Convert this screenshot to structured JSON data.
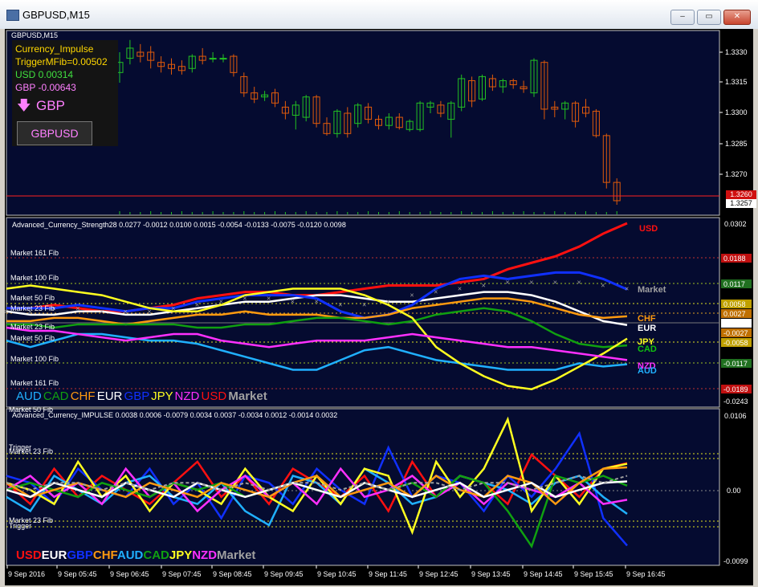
{
  "window": {
    "title": "GBPUSD,M15",
    "min": "‒",
    "max": "▭",
    "close": "✕"
  },
  "main": {
    "symbol": "GBPUSD,M15",
    "indicator_name": "Currency_Impulse",
    "trigger": "TriggerMFib=0.00502",
    "usd": "USD 0.00314",
    "gbp": "GBP -0.00643",
    "arrow": "🡇",
    "arrow_label": "GBP",
    "button": "GBPUSD",
    "price_ticks": [
      "1.3330",
      "1.3315",
      "1.3300",
      "1.3285",
      "1.3270"
    ],
    "bid_label": "1.3260",
    "ask_label": "1.3257",
    "colors": {
      "bull": "#22c022",
      "bear": "#e05a0a",
      "bid": "#ff2020"
    }
  },
  "strength": {
    "header": "Advanced_Currency_Strength28  0.0277 -0.0012 0.0100 0.0015 -0.0054 -0.0133 -0.0075 -0.0120 0.0098",
    "fib_labels": [
      "Market 161 Fib",
      "Market 100 Fib",
      "Market 50 Fib",
      "Market 23 Fib",
      "Market 23 Fib",
      "Market 50 Fib",
      "Market 100 Fib",
      "Market 161 Fib"
    ],
    "right_tags": [
      "USD",
      "Market",
      "CHF",
      "EUR",
      "JPY",
      "CAD",
      "NZD",
      "AUD"
    ],
    "axis_top": "0.0302",
    "axis_bottom": "-0.0243",
    "boxes": [
      "0.0188",
      "0.0117",
      "0.0058",
      "0.0027",
      "0.0000",
      "-0.0027",
      "-0.0058",
      "-0.0117",
      "-0.0189"
    ],
    "legend": [
      "AUD",
      "CAD",
      "CHF",
      "EUR",
      "GBP",
      "JPY",
      "NZD",
      "USD",
      "Market"
    ]
  },
  "impulse": {
    "header": "Advanced_Currency_IMPULSE  0.0038 0.0006 -0.0079 0.0034 0.0037 -0.0034 0.0012 -0.0014 0.0032",
    "labels": [
      "Market 50 Fib",
      "Trigger",
      "Market 23 Fib",
      "Market 23 Fib",
      "Trigger"
    ],
    "axis": [
      "0.0106",
      "0.00",
      "-0.0099"
    ],
    "legend": [
      "USD",
      "EUR",
      "GBP",
      "CHF",
      "AUD",
      "CAD",
      "JPY",
      "NZD",
      "Market"
    ]
  },
  "time_axis": [
    "9 Sep 2016",
    "9 Sep 05:45",
    "9 Sep 06:45",
    "9 Sep 07:45",
    "9 Sep 08:45",
    "9 Sep 09:45",
    "9 Sep 10:45",
    "9 Sep 11:45",
    "9 Sep 12:45",
    "9 Sep 13:45",
    "9 Sep 14:45",
    "9 Sep 15:45",
    "9 Sep 16:45"
  ],
  "currency_colors": {
    "USD": "#ff1010",
    "EUR": "#ffffff",
    "GBP": "#1030ff",
    "CHF": "#ff9a10",
    "AUD": "#20b0ff",
    "CAD": "#10a010",
    "JPY": "#ffff20",
    "NZD": "#ff30ff",
    "Market": "#a0a0a0"
  }
}
